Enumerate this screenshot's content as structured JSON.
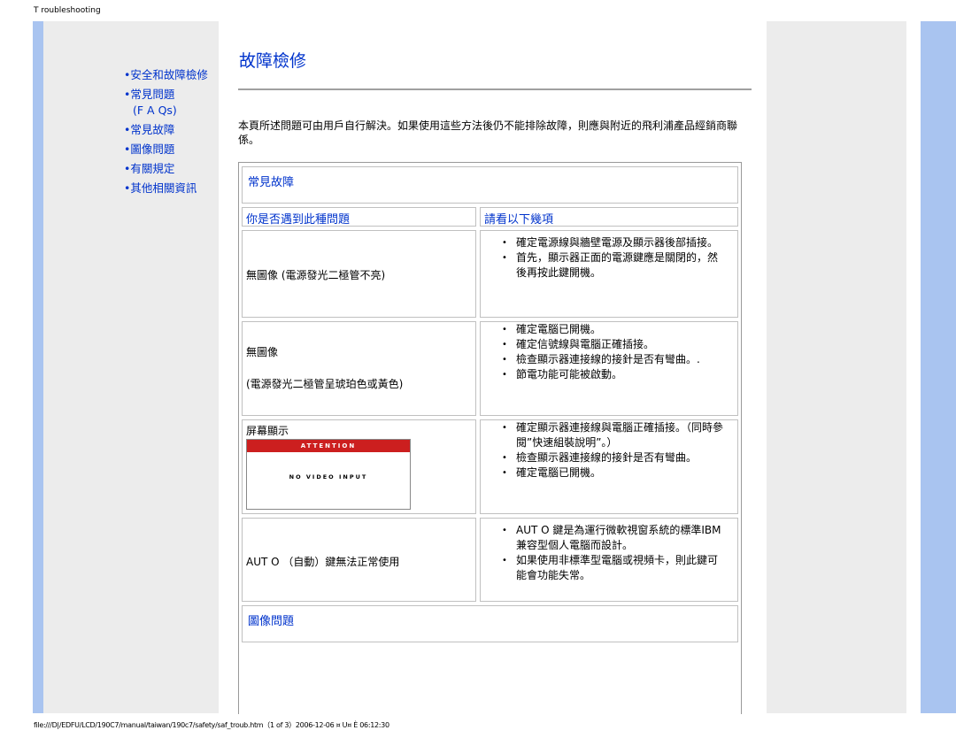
{
  "header": {
    "running_title": "T roubleshooting"
  },
  "footer": {
    "path": "file:///D|/EDFU/LCD/190C7/manual/taiwan/190c7/safety/saf_troub.htm（1 of 3）2006-12-06 ¤ U¤ È  06:12:30"
  },
  "colors": {
    "link": "#0033cc",
    "side_blue": "#a9c4f0",
    "side_gray": "#ececec",
    "attention_red": "#cc1f1f"
  },
  "nav": [
    {
      "label": "•安全和故障檢修"
    },
    {
      "label": "•常見問題"
    },
    {
      "label": "(F A Qs)"
    },
    {
      "label": "•常見故障"
    },
    {
      "label": "•圖像問題"
    },
    {
      "label": "•有關規定"
    },
    {
      "label": "•其他相關資訊"
    }
  ],
  "page": {
    "title": "故障檢修",
    "intro": "本頁所述問題可由用戶自行解決。如果使用這些方法後仍不能排除故障，則應與附近的飛利浦產品經銷商聯係。"
  },
  "table": {
    "section_title": "常見故障",
    "col_problem": "你是否遇到此種問題",
    "col_check": "請看以下幾項",
    "rows": [
      {
        "problem": [
          "無圖像 (電源發光二極管不亮)"
        ],
        "checks": [
          "確定電源線與牆壁電源及顯示器後部插接。",
          "首先，顯示器正面的電源鍵應是關閉的，然後再按此鍵開機。"
        ]
      },
      {
        "problem": [
          "無圖像",
          "(電源發光二極管呈琥珀色或黃色)"
        ],
        "checks": [
          "確定電腦已開機。",
          "確定信號線與電腦正確插接。",
          "檢查顯示器連接線的接針是否有彎曲。.",
          "節電功能可能被啟動。"
        ]
      },
      {
        "problem": [
          "屏幕顯示"
        ],
        "checks": [
          "確定顯示器連接線與電腦正確插接。（同時參閱”快速組裝說明”。）",
          "檢查顯示器連接線的接針是否有彎曲。",
          "確定電腦已開機。"
        ]
      },
      {
        "problem": [
          "AUT O （自動）鍵無法正常使用"
        ],
        "checks": [
          "AUT O 鍵是為運行微軟視窗系統的標準IBM兼容型個人電腦而設計。",
          "如果使用非標準型電腦或視頻卡，則此鍵可能會功能失常。"
        ]
      }
    ],
    "next_section_title": "圖像問題"
  },
  "osd_image": {
    "banner": "ATTENTION",
    "message": "NO VIDEO INPUT"
  }
}
